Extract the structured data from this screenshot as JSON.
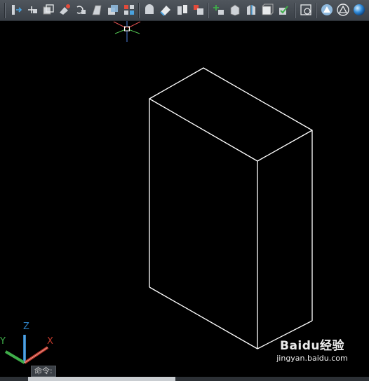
{
  "toolbar": {
    "groups": [
      [
        "extrude-icon",
        "move-icon",
        "copy-icon",
        "color-face-icon",
        "rotate-icon",
        "taper-icon",
        "offset-icon",
        "delete-face-icon"
      ],
      [
        "imprint-icon",
        "clean-icon",
        "separate-icon",
        "shell-icon"
      ],
      [
        "add-vertex-icon",
        "box-icon",
        "wedge-icon",
        "cube-icon",
        "check-icon"
      ],
      [
        "view-icon"
      ],
      [
        "sphere-render-icon",
        "triangle-render-icon",
        "blue-sphere-icon"
      ]
    ],
    "accent_colors": {
      "red": "#e34b3b",
      "blue": "#4aa3e0",
      "white": "#ffffff"
    }
  },
  "ucs_icon": {
    "z_label": "Z",
    "y_label": "Y",
    "x_label": "X",
    "colors": {
      "z": "#2d7fc1",
      "y": "#3fae4a",
      "x": "#c0392b"
    }
  },
  "model": {
    "edge_color": "#ffffff",
    "shape": "box"
  },
  "crosshair": {
    "colors": {
      "x": "#e05050",
      "y": "#50c050",
      "z": "#5080e0"
    }
  },
  "command_line": {
    "prompt": "命令:"
  },
  "watermark": {
    "brand": "Baidu经验",
    "url": "jingyan.baidu.com"
  }
}
